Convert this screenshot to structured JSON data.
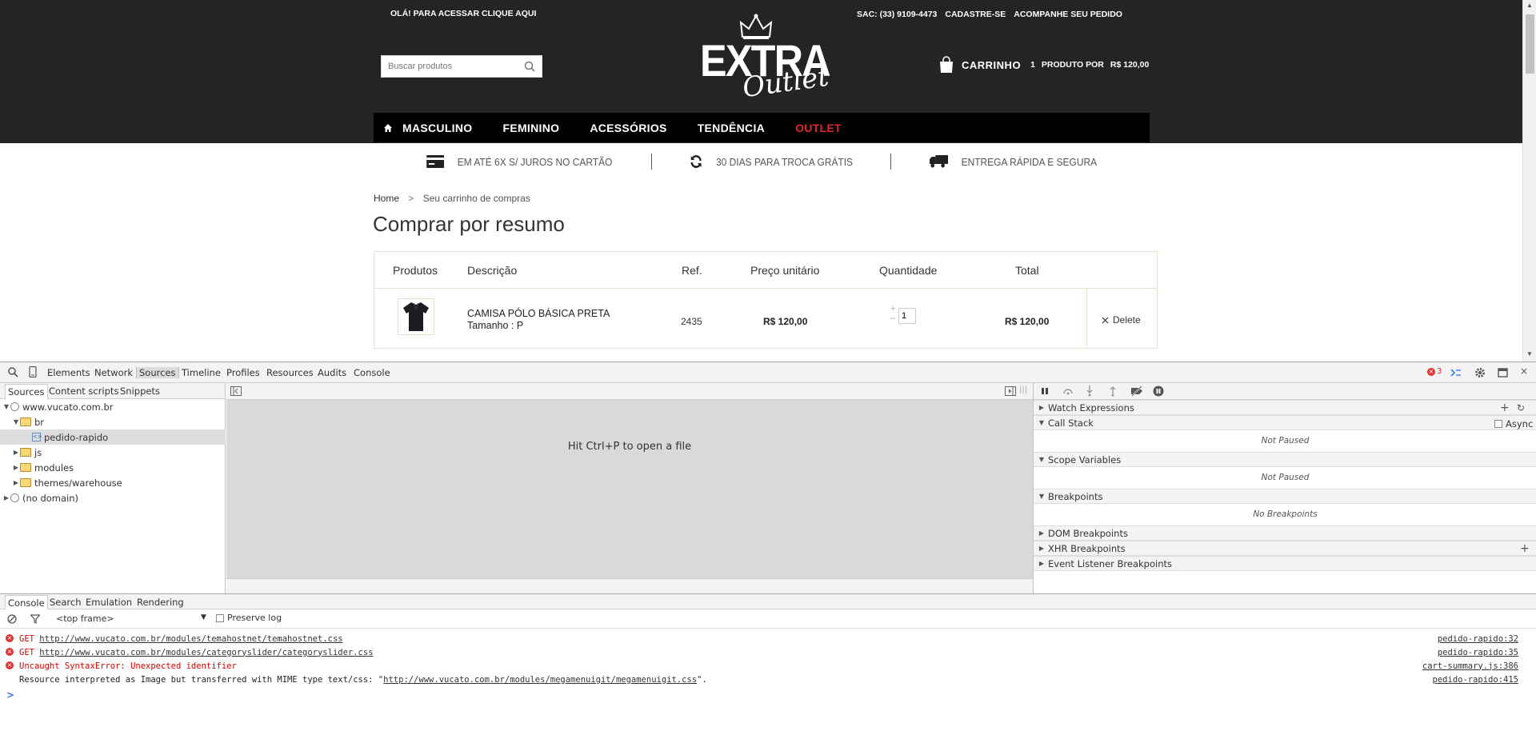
{
  "site": {
    "top_bar": {
      "hello": "OLÁ! PARA ACESSAR CLIQUE AQUI",
      "sac": "SAC: (33) 9109-4473",
      "register": "CADASTRE-SE",
      "track": "ACOMPANHE SEU PEDIDO"
    },
    "search": {
      "placeholder": "Buscar produtos"
    },
    "logo": {
      "line1": "EXTRA",
      "line2": "Outlet"
    },
    "cart": {
      "label": "CARRINHO",
      "count": "1",
      "product_por": "PRODUTO POR",
      "amount": "R$ 120,00"
    },
    "menu": [
      "MASCULINO",
      "FEMININO",
      "ACESSÓRIOS",
      "TENDÊNCIA",
      "OUTLET"
    ],
    "benefits": [
      "EM ATÉ 6X S/ JUROS NO CARTÃO",
      "30 DIAS PARA TROCA GRÁTIS",
      "ENTREGA RÁPIDA E SEGURA"
    ],
    "breadcrumb": {
      "home": "Home",
      "sep": ">",
      "current": "Seu carrinho de compras"
    },
    "page_title": "Comprar por resumo",
    "table": {
      "headers": {
        "products": "Produtos",
        "description": "Descrição",
        "ref": "Ref.",
        "unit_price": "Preço unitário",
        "quantity": "Quantidade",
        "total": "Total"
      },
      "row": {
        "name": "CAMISA PÓLO BÁSICA PRETA",
        "size": "Tamanho : P",
        "ref": "2435",
        "unit_price": "R$ 120,00",
        "quantity": "1",
        "total": "R$ 120,00",
        "delete": "Delete"
      }
    }
  },
  "devtools": {
    "tabs": [
      "Elements",
      "Network",
      "Sources",
      "Timeline",
      "Profiles",
      "Resources",
      "Audits",
      "Console"
    ],
    "active_tab": "Sources",
    "error_count": "3",
    "navigator_tabs": [
      "Sources",
      "Content scripts",
      "Snippets"
    ],
    "tree": {
      "domain": "www.vucato.com.br",
      "br": "br",
      "file": "pedido-rapido",
      "js": "js",
      "modules": "modules",
      "themes": "themes/warehouse",
      "no_domain": "(no domain)"
    },
    "editor_hint": "Hit Ctrl+P to open a file",
    "sidebar": {
      "watch": "Watch Expressions",
      "call_stack": "Call Stack",
      "async": "Async",
      "not_paused_1": "Not Paused",
      "scope": "Scope Variables",
      "not_paused_2": "Not Paused",
      "breakpoints": "Breakpoints",
      "no_breakpoints": "No Breakpoints",
      "dom_breakpoints": "DOM Breakpoints",
      "xhr_breakpoints": "XHR Breakpoints",
      "event_breakpoints": "Event Listener Breakpoints"
    },
    "drawer_tabs": [
      "Console",
      "Search",
      "Emulation",
      "Rendering"
    ],
    "console": {
      "frame": "<top frame>",
      "preserve_log": "Preserve log",
      "logs": [
        {
          "type": "error",
          "method": "GET",
          "url": "http://www.vucato.com.br/modules/temahostnet/temahostnet.css",
          "source": "pedido-rapido:32"
        },
        {
          "type": "error",
          "method": "GET",
          "url": "http://www.vucato.com.br/modules/categoryslider/categoryslider.css",
          "source": "pedido-rapido:35"
        },
        {
          "type": "error",
          "method": "",
          "text": "Uncaught SyntaxError: Unexpected identifier",
          "source": "cart-summary.js:386"
        },
        {
          "type": "info",
          "prefix": "Resource interpreted as Image but transferred with MIME type text/css: \"",
          "url": "http://www.vucato.com.br/modules/megamenuigit/megamenuigit.css",
          "suffix": "\".",
          "source": "pedido-rapido:415"
        }
      ],
      "prompt": ">"
    }
  }
}
